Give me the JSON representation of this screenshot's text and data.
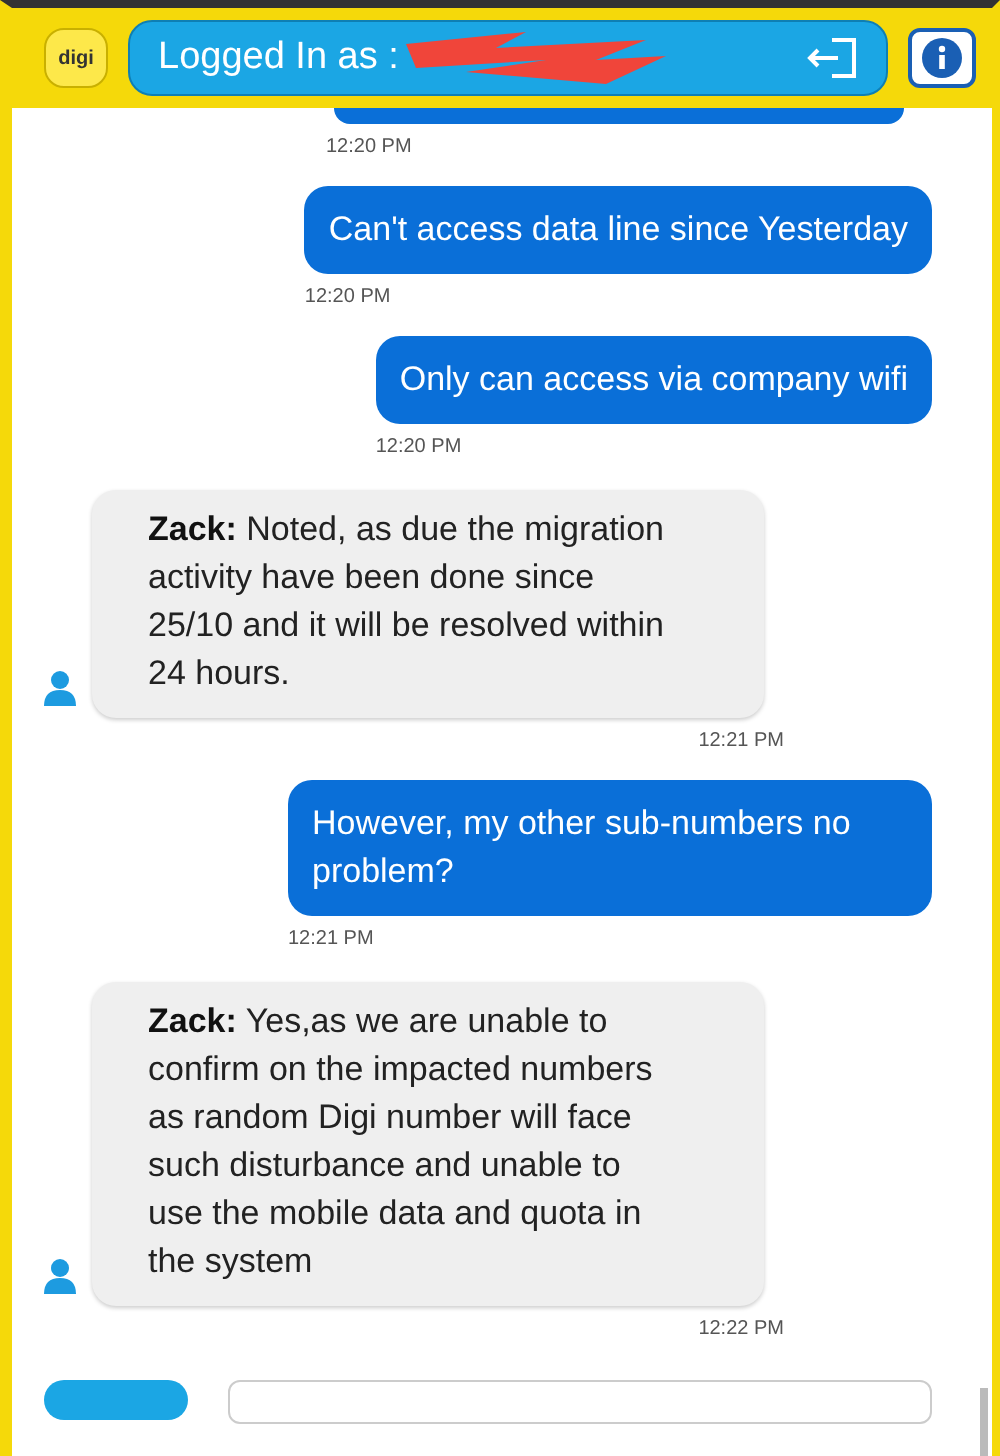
{
  "header": {
    "logo": "digi",
    "label": "Logged In as :",
    "redacted": true
  },
  "messages": [
    {
      "kind": "clipped",
      "time": "12:20 PM"
    },
    {
      "kind": "user",
      "text": "Can't access data line since Yesterday",
      "time": "12:20 PM"
    },
    {
      "kind": "user",
      "text": "Only can access via company wifi",
      "time": "12:20 PM"
    },
    {
      "kind": "agent",
      "sender": "Zack:",
      "text": "Noted, as due the migration activity have been done since 25/10 and it will be resolved within 24 hours.",
      "time": "12:21 PM"
    },
    {
      "kind": "user",
      "text": "However, my other sub-numbers no problem?",
      "time": "12:21 PM"
    },
    {
      "kind": "agent",
      "sender": "Zack:",
      "text": "Yes,as we are unable to confirm on the impacted numbers as random Digi number will face such disturbance and unable to use the mobile data and quota in the system",
      "time": "12:22 PM"
    }
  ]
}
